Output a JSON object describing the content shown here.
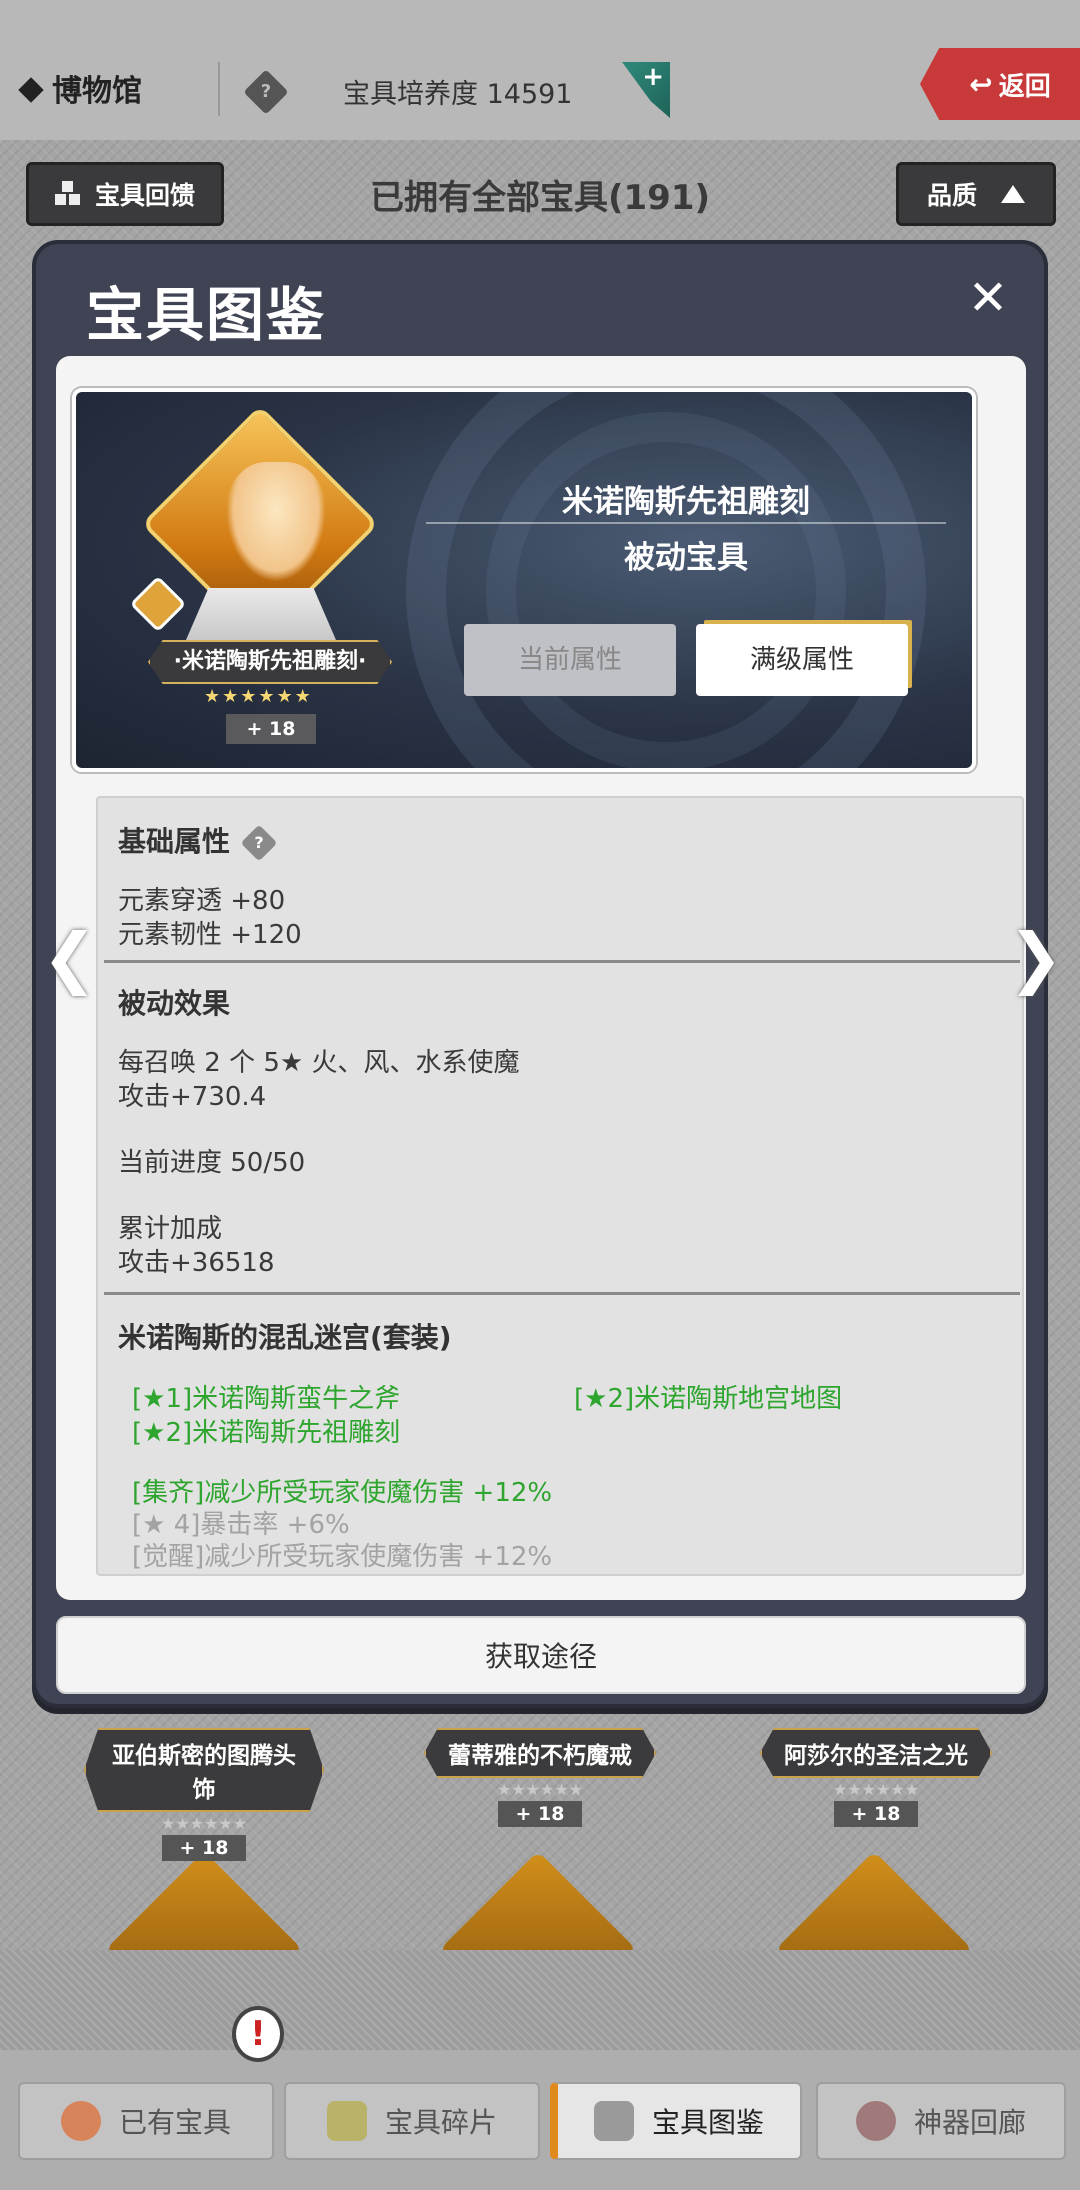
{
  "header": {
    "title": "博物馆",
    "cultivation_label": "宝具培养度 14591",
    "plus_label": "+",
    "back_label": "返回"
  },
  "subbar": {
    "feedback_label": "宝具回馈",
    "owned_label": "已拥有全部宝具(191)",
    "quality_label": "品质"
  },
  "background_items": [
    {
      "name": "亚伯斯密的图腾头饰",
      "stars": "★★★★★★",
      "level": "+ 18"
    },
    {
      "name": "蕾蒂雅的不朽魔戒",
      "stars": "★★★★★★",
      "level": "+ 18"
    },
    {
      "name": "阿莎尔的圣洁之光",
      "stars": "★★★★★★",
      "level": "+ 18"
    }
  ],
  "modal": {
    "title": "宝具图鉴",
    "close_icon": "close-icon",
    "relic": {
      "nameplate": "·米诺陶斯先祖雕刻·",
      "stars": "★★★★★★",
      "level": "+ 18",
      "name": "米诺陶斯先祖雕刻",
      "type": "被动宝具"
    },
    "tabs": {
      "current": "当前属性",
      "max": "满级属性"
    },
    "basic": {
      "title": "基础属性",
      "help": "?",
      "lines": [
        "元素穿透 +80",
        "元素韧性 +120"
      ]
    },
    "passive": {
      "title": "被动效果",
      "desc1": "每召唤 2 个 5★ 火、风、水系使魔",
      "desc2": "攻击+730.4",
      "progress": "当前进度 50/50",
      "total_label": "累计加成",
      "total_value": "攻击+36518"
    },
    "set": {
      "title": "米诺陶斯的混乱迷宫(套装)",
      "pieces": [
        "[★1]米诺陶斯蛮牛之斧",
        "[★2]米诺陶斯地宫地图",
        "[★2]米诺陶斯先祖雕刻"
      ],
      "effect_active": "[集齐]减少所受玩家使魔伤害 +12%",
      "effect_inactive1": "[★ 4]暴击率 +6%",
      "effect_inactive2": "[觉醒]减少所受玩家使魔伤害 +12%"
    },
    "obtain_label": "获取途径",
    "nav_left": "❮",
    "nav_right": "❯"
  },
  "bottom_nav": {
    "tabs": [
      "已有宝具",
      "宝具碎片",
      "宝具图鉴",
      "神器回廊"
    ],
    "active_index": 2,
    "alert": "!"
  },
  "colors": {
    "modal_bg": "#3f4354",
    "accent_red": "#c83a3a",
    "set_green": "#2ea52e",
    "active_tab_accent": "#e08a1e"
  }
}
